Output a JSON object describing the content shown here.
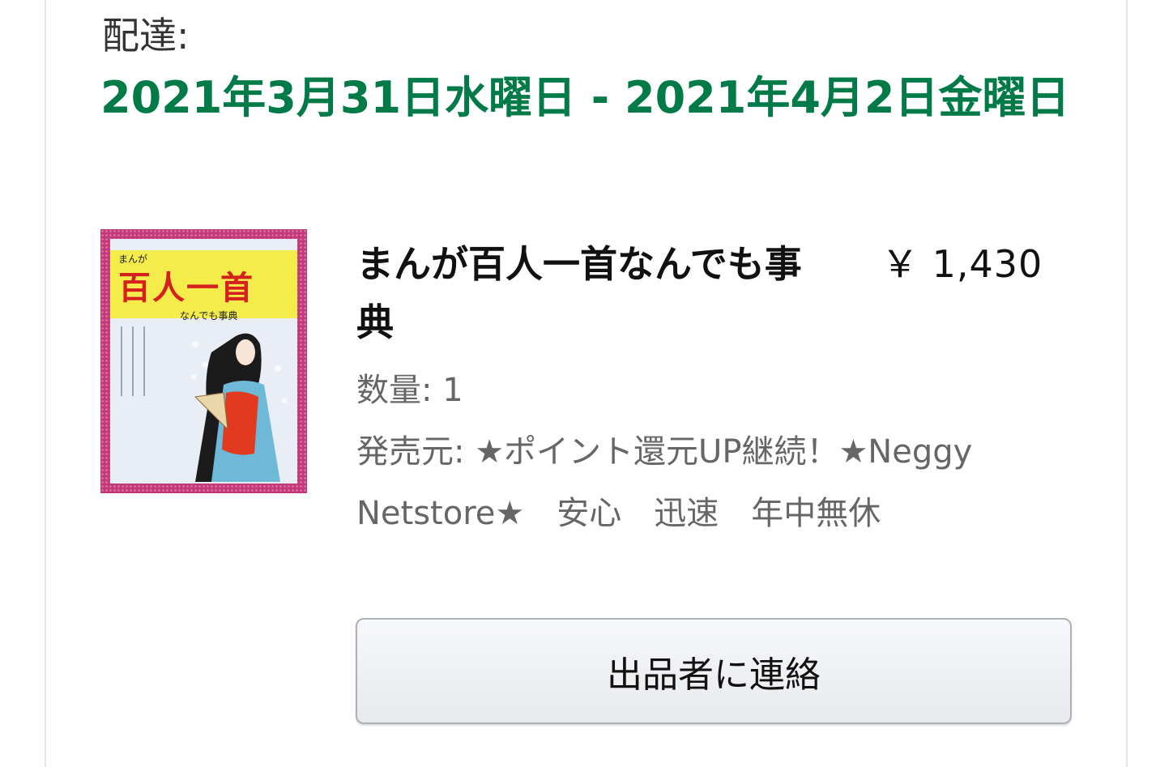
{
  "delivery": {
    "label": "配達:",
    "dates": "2021年3月31日水曜日 - 2021年4月2日金曜日"
  },
  "item": {
    "cover": {
      "small_text": "まんが",
      "title": "百人一首",
      "subtitle": "なんでも事典"
    },
    "title": "まんが百人一首なんでも事典",
    "price": "￥ 1,430",
    "quantity": "数量: 1",
    "seller": "発売元: ★ポイント還元UP継続！★Neggy　Netstore★　安心　迅速　年中無休"
  },
  "actions": {
    "contact_seller": "出品者に連絡"
  },
  "colors": {
    "delivery_green": "#007a47",
    "text_dark": "#111111",
    "text_gray": "#666666"
  }
}
